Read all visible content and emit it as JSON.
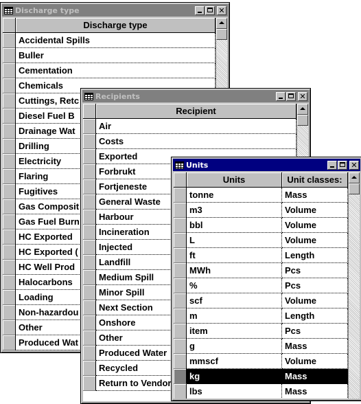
{
  "discharge_window": {
    "title": "Discharge type",
    "column_header": "Discharge type",
    "rows": [
      "Accidental Spills",
      "Buller",
      "Cementation",
      "Chemicals",
      "Cuttings, Retc",
      "Diesel Fuel B",
      "Drainage Wat",
      "Drilling",
      "Electricity",
      "Flaring",
      "Fugitives",
      "Gas Composit",
      "Gas Fuel Burn",
      "HC Exported",
      "HC Exported (",
      "HC Well Prod",
      "Halocarbons",
      "Loading",
      "Non-hazardou",
      "Other",
      "Produced Wat"
    ]
  },
  "recipients_window": {
    "title": "Recipients",
    "column_header": "Recipient",
    "rows": [
      "Air",
      "Costs",
      "Exported",
      "Forbrukt",
      "Fortjeneste",
      "General Waste",
      "Harbour",
      "Incineration",
      "Injected",
      "Landfill",
      "Medium Spill",
      "Minor Spill",
      "Next Section",
      "Onshore",
      "Other",
      "Produced Water",
      "Recycled",
      "Return to Vendor"
    ]
  },
  "units_window": {
    "title": "Units",
    "column_headers": [
      "Units",
      "Unit classes:"
    ],
    "rows": [
      [
        "tonne",
        "Mass"
      ],
      [
        "m3",
        "Volume"
      ],
      [
        "bbl",
        "Volume"
      ],
      [
        "L",
        "Volume"
      ],
      [
        "ft",
        "Length"
      ],
      [
        "MWh",
        "Pcs"
      ],
      [
        "%",
        "Pcs"
      ],
      [
        "scf",
        "Volume"
      ],
      [
        "m",
        "Length"
      ],
      [
        "item",
        "Pcs"
      ],
      [
        "g",
        "Mass"
      ],
      [
        "mmscf",
        "Volume"
      ],
      [
        "kg",
        "Mass"
      ],
      [
        "lbs",
        "Mass"
      ]
    ],
    "selected_row": 12
  },
  "icons": {
    "window_icon": "table-grid-icon",
    "minimize": "minimize-icon",
    "maximize": "maximize-icon",
    "close": "close-icon",
    "scroll_up": "scroll-up-arrow-icon"
  },
  "colors": {
    "active_title": "#000080",
    "inactive_title": "#808080",
    "face": "#c0c0c0",
    "selection": "#000000"
  }
}
